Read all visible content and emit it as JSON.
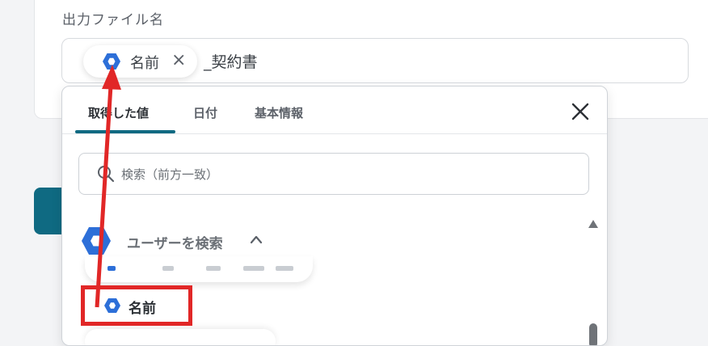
{
  "field": {
    "label": "出力ファイル名",
    "chip_label": "名前",
    "chip_close": "×",
    "suffix_text": "_契約書"
  },
  "dropdown": {
    "tabs": [
      {
        "label": "取得した値",
        "active": true
      },
      {
        "label": "日付",
        "active": false
      },
      {
        "label": "基本情報",
        "active": false
      }
    ],
    "search_placeholder": "検索（前方一致）",
    "group_label": "ユーザーを検索",
    "selected_item_label": "名前"
  },
  "icons": {
    "chip_icon": "google-workspace-hex-icon",
    "group_icon": "google-workspace-hex-icon",
    "item_icon": "google-workspace-hex-icon",
    "search": "search-icon",
    "close": "close-icon",
    "chevron": "chevron-up-icon"
  },
  "colors": {
    "accent": "#0f6a82",
    "highlight": "#e12727",
    "google_blue": "#2d6fd8"
  }
}
